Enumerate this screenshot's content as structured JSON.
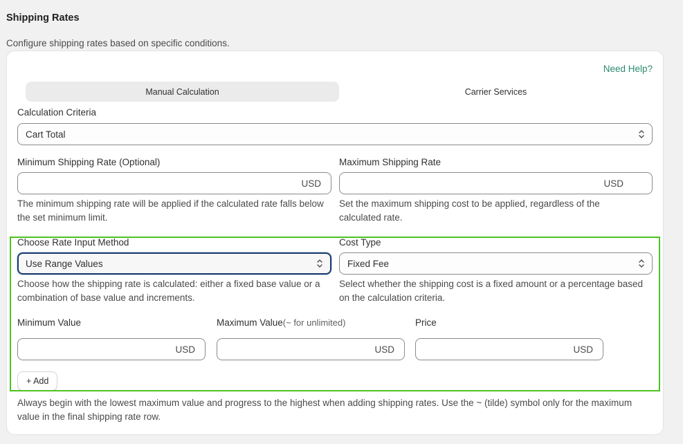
{
  "header": {
    "title": "Shipping Rates",
    "subtitle": "Configure shipping rates based on specific conditions."
  },
  "card": {
    "help_link": "Need Help?",
    "tabs": [
      {
        "label": "Manual Calculation",
        "active": true
      },
      {
        "label": "Carrier Services",
        "active": false
      }
    ],
    "criteria": {
      "label": "Calculation Criteria",
      "value": "Cart Total"
    },
    "min_rate": {
      "label": "Minimum Shipping Rate (Optional)",
      "currency": "USD",
      "help": "The minimum shipping rate will be applied if the calculated rate falls below the set minimum limit."
    },
    "max_rate": {
      "label": "Maximum Shipping Rate",
      "currency": "USD",
      "help": "Set the maximum shipping cost to be applied, regardless of the calculated rate."
    },
    "rate_method": {
      "label": "Choose Rate Input Method",
      "value": "Use Range Values",
      "help": "Choose how the shipping rate is calculated: either a fixed base value or a combination of base value and increments."
    },
    "cost_type": {
      "label": "Cost Type",
      "value": "Fixed Fee",
      "help": "Select whether the shipping cost is a fixed amount or a percentage based on the calculation criteria."
    },
    "range": {
      "min_label": "Minimum Value",
      "max_label": "Maximum Value",
      "max_hint": "(~ for unlimited)",
      "price_label": "Price",
      "currency": "USD",
      "add_button": "+ Add"
    },
    "footer_note": "Always begin with the lowest maximum value and progress to the highest when adding shipping rates. Use the ~ (tilde) symbol only for the maximum value in the final shipping rate row."
  },
  "colors": {
    "accent_link": "#2b8a6e",
    "highlight_border": "#4cc41f",
    "focus_ring": "#1a3a6b"
  }
}
